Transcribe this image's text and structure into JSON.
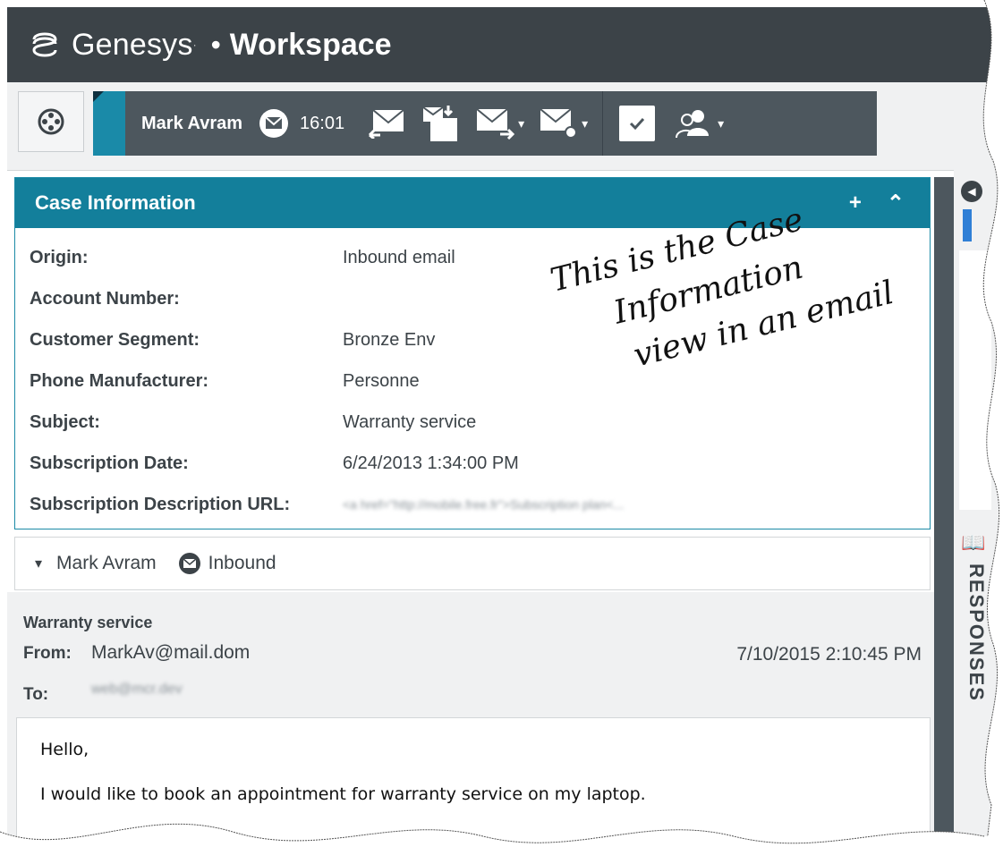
{
  "app": {
    "brand": "Genesys",
    "trademark": "·",
    "separator": "•",
    "product": "Workspace"
  },
  "interaction_bar": {
    "party_name": "Mark Avram",
    "media_icon": "email-icon",
    "timer": "16:01",
    "actions": [
      {
        "name": "reply-email-icon",
        "caret": false
      },
      {
        "name": "transfer-icon",
        "caret": false
      },
      {
        "name": "forward-email-icon",
        "caret": true
      },
      {
        "name": "email-options-icon",
        "caret": true
      },
      {
        "name": "mark-done-icon",
        "caret": false
      },
      {
        "name": "consult-party-icon",
        "caret": true
      }
    ],
    "caret_glyph": "▾"
  },
  "case_information": {
    "title": "Case Information",
    "add_glyph": "+",
    "collapse_glyph": "⌃",
    "rows": [
      {
        "label": "Origin:",
        "value": "Inbound email"
      },
      {
        "label": "Account Number:",
        "value": ""
      },
      {
        "label": "Customer Segment:",
        "value": "Bronze Env"
      },
      {
        "label": "Phone Manufacturer:",
        "value": "Personne"
      },
      {
        "label": "Subject:",
        "value": "Warranty service"
      },
      {
        "label": "Subscription Date:",
        "value": "6/24/2013 1:34:00 PM"
      },
      {
        "label": "Subscription Description URL:",
        "value": "<a href=\"http://mobile.free.fr\">Subscription plan<..."
      }
    ]
  },
  "annotation": {
    "lines": [
      "This is the Case",
      "Information",
      "view in an email"
    ]
  },
  "interaction_header": {
    "caret": "▾",
    "party_name": "Mark Avram",
    "direction": "Inbound"
  },
  "email": {
    "subject": "Warranty service",
    "from_label": "From:",
    "from": "MarkAv@mail.dom",
    "date": "7/10/2015 2:10:45 PM",
    "to_label": "To:",
    "to": "web@mcr.dev",
    "body": [
      "Hello,",
      "I would like to book an appointment for warranty service on my laptop."
    ]
  },
  "side_panel": {
    "collapse_glyph": "◀",
    "book_glyph": "📖",
    "responses_label": "RESPONSES"
  },
  "colors": {
    "title_bar": "#3c4348",
    "interaction_bar": "#4d575e",
    "accent": "#1a8aa8",
    "case_header": "#137f9b"
  }
}
